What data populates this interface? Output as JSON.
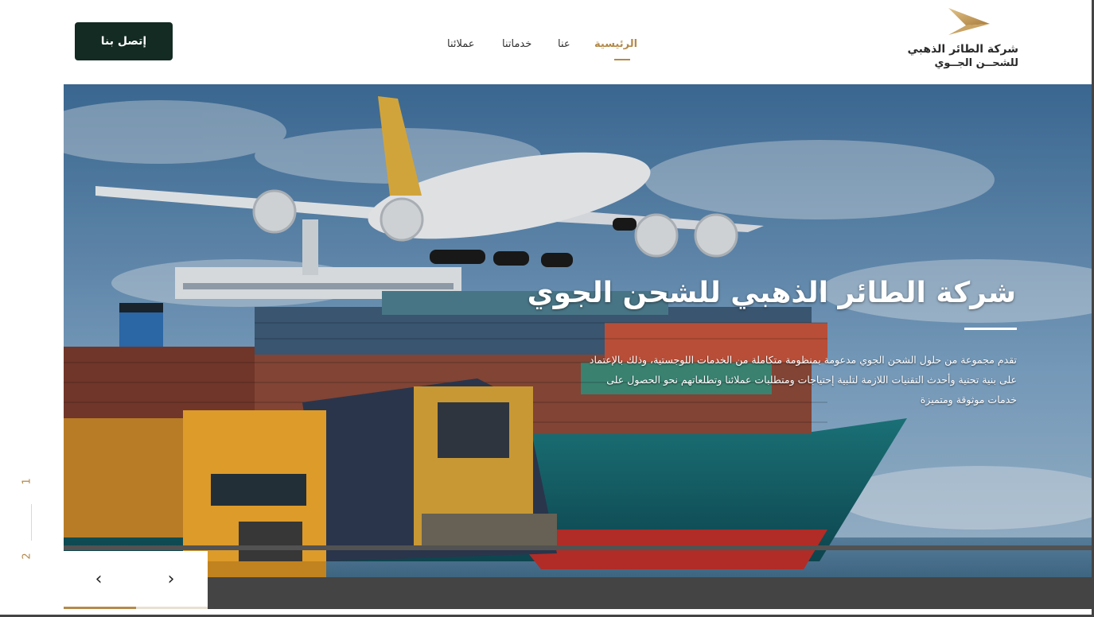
{
  "header": {
    "contact_label": "إتصل بنا",
    "nav": [
      {
        "label": "الرئيسية",
        "active": true
      },
      {
        "label": "عنا",
        "active": false
      },
      {
        "label": "خدماتنا",
        "active": false
      },
      {
        "label": "عملائنا",
        "active": false
      }
    ],
    "logo": {
      "line1": "شركة الطائر الذهبي",
      "line2": "للشحــن الجــوي",
      "icon": "golden-bird-icon"
    }
  },
  "hero": {
    "title": "شركة الطائر الذهبي للشحن الجوي",
    "body": "تقدم مجموعة من حلول الشحن الجوي مدعومة بمنظومة متكاملة من الخدمات اللوجستية، وذلك بالإعتماد على بنية تحتية وأحدث التقنيات اللازمة لتلبية إحتياجات ومتطلبات عملائنا وتطلعاتهم نحو الحصول على خدمات موثوقة ومتميزة",
    "image": "cargo-logistics-scene"
  },
  "slider": {
    "current": "1",
    "total": "2",
    "prev_icon": "chevron-left-icon",
    "next_icon": "chevron-right-icon",
    "progress": 0.5
  },
  "colors": {
    "accent": "#b48a4a",
    "button_bg": "#132b22"
  }
}
